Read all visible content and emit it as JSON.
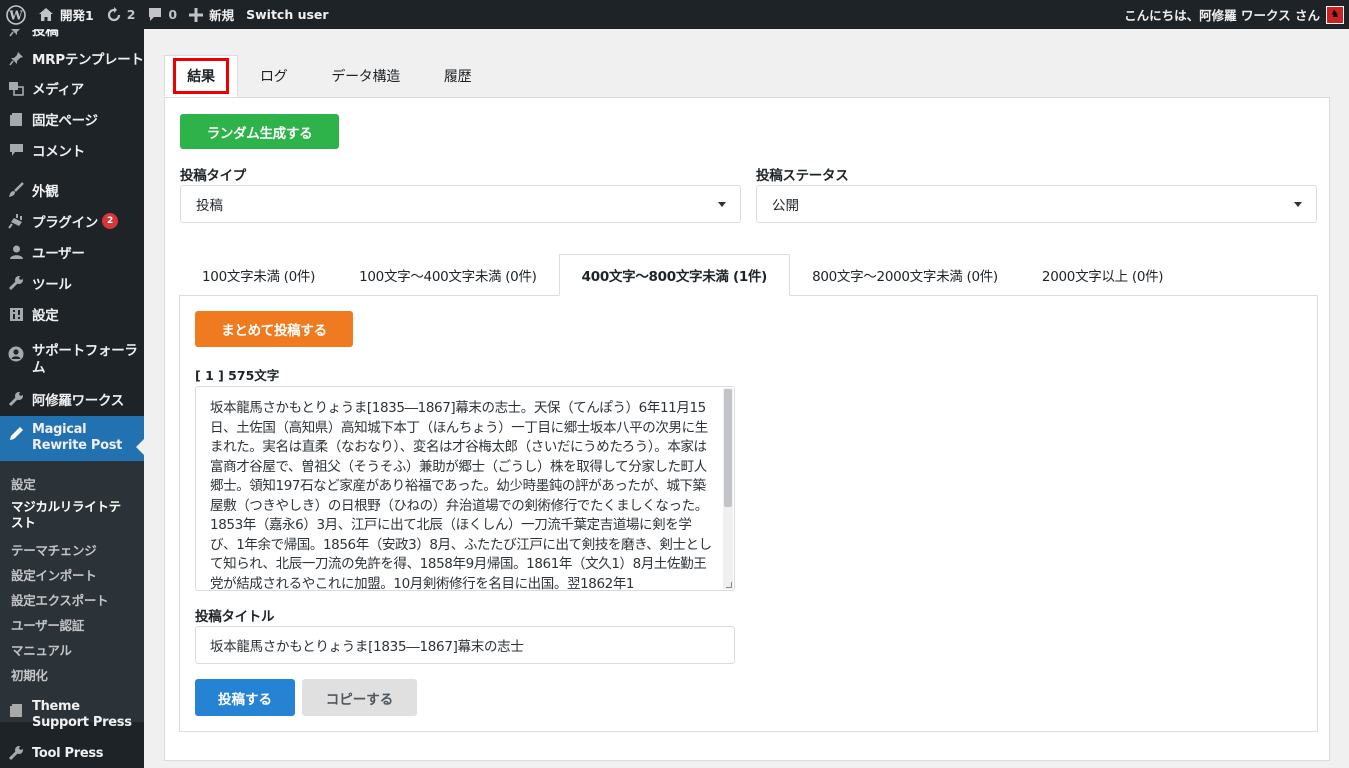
{
  "adminbar": {
    "site_name": "開発1",
    "updates_count": "2",
    "comments_count": "0",
    "new_label": "新規",
    "switch_user": "Switch user",
    "greeting": "こんにちは、阿修羅 ワークス さん"
  },
  "sidebar": {
    "items": [
      {
        "label": "投稿"
      },
      {
        "label": "MRPテンプレート"
      },
      {
        "label": "メディア"
      },
      {
        "label": "固定ページ"
      },
      {
        "label": "コメント"
      },
      {
        "label": "外観"
      },
      {
        "label": "プラグイン",
        "badge": "2"
      },
      {
        "label": "ユーザー"
      },
      {
        "label": "ツール"
      },
      {
        "label": "設定"
      },
      {
        "label": "サポートフォーラム"
      },
      {
        "label": "阿修羅ワークス"
      },
      {
        "label": "Magical Rewrite Post"
      },
      {
        "label": "Theme Support Press"
      },
      {
        "label": "Tool Press"
      }
    ],
    "submenu": [
      {
        "label": "設定"
      },
      {
        "label": "マジカルリライトテスト"
      },
      {
        "label": "テーマチェンジ"
      },
      {
        "label": "設定インポート"
      },
      {
        "label": "設定エクスポート"
      },
      {
        "label": "ユーザー認証"
      },
      {
        "label": "マニュアル"
      },
      {
        "label": "初期化"
      }
    ]
  },
  "main": {
    "tabs": [
      {
        "label": "結果"
      },
      {
        "label": "ログ"
      },
      {
        "label": "データ構造"
      },
      {
        "label": "履歴"
      }
    ],
    "generate_button": "ランダム生成する",
    "post_type": {
      "label": "投稿タイプ",
      "value": "投稿"
    },
    "post_status": {
      "label": "投稿ステータス",
      "value": "公開"
    },
    "length_tabs": [
      {
        "label": "100文字未満 (0件)"
      },
      {
        "label": "100文字～400文字未満 (0件)"
      },
      {
        "label": "400文字～800文字未満 (1件)"
      },
      {
        "label": "800文字～2000文字未満 (0件)"
      },
      {
        "label": "2000文字以上 (0件)"
      }
    ],
    "bulk_post_button": "まとめて投稿する",
    "entry": {
      "count_label": "[ 1 ] 575文字",
      "body": "坂本龍馬さかもとりょうま[1835―1867]幕末の志士。天保（てんぽう）6年11月15日、土佐国（高知県）高知城下本丁（ほんちょう）一丁目に郷士坂本八平の次男に生まれた。実名は直柔（なおなり）、変名は才谷梅太郎（さいだにうめたろう）。本家は富商才谷屋で、曽祖父（そうそふ）兼助が郷士（ごうし）株を取得して分家した町人郷士。領知197石など家産があり裕福であった。幼少時墨鈍の評があったが、城下築屋敷（つきやしき）の日根野（ひねの）弁治道場での剣術修行でたくましくなった。1853年（嘉永6）3月、江戸に出て北辰（ほくしん）一刀流千葉定吉道場に剣を学び、1年余で帰国。1856年（安政3）8月、ふたたび江戸に出て剣技を磨き、剣士として知られ、北辰一刀流の免許を得、1858年9月帰国。1861年（文久1）8月土佐勤王党が結成されるやこれに加盟。10月剣術修行を名目に出国。翌1862年1",
      "title_label": "投稿タイトル",
      "title_value": "坂本龍馬さかもとりょうま[1835―1867]幕末の志士",
      "post_button": "投稿する",
      "copy_button": "コピーする"
    }
  },
  "colors": {
    "admin_dark": "#1d2327",
    "active_menu": "#2271b1",
    "green": "#2db34a",
    "orange": "#f07a1f",
    "blue": "#2682d2",
    "highlight_red": "#e00000"
  }
}
